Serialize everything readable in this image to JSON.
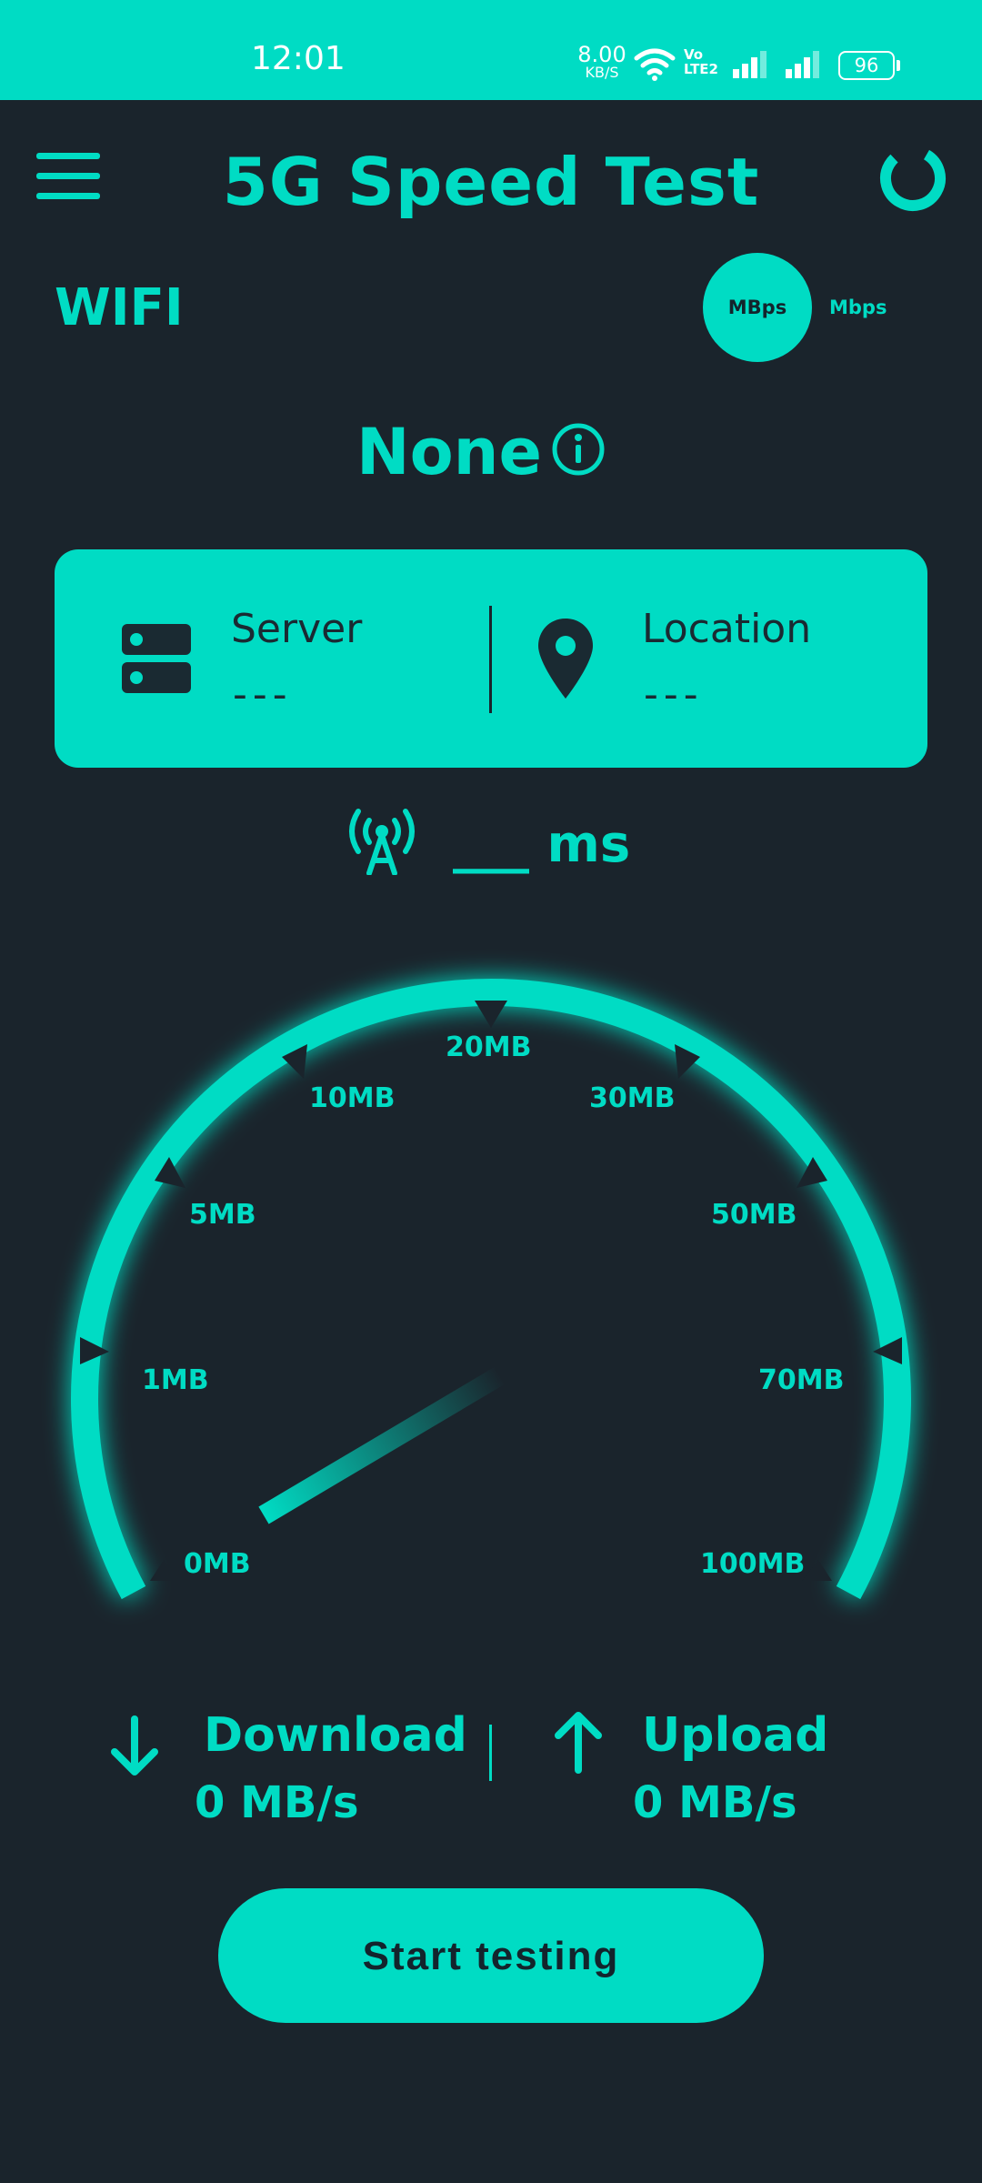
{
  "status_bar": {
    "time": "12:01",
    "net_speed": "8.00",
    "net_speed_unit": "KB/S",
    "volte_line1": "Vo",
    "volte_line2": "LTE2",
    "battery": "96"
  },
  "header": {
    "title": "5G Speed Test",
    "menu_icon": "hamburger-menu-icon",
    "refresh_icon": "circle-loader-icon"
  },
  "connection": {
    "type": "WIFI",
    "unit_selected": "MBps",
    "unit_other": "Mbps",
    "network_name": "None"
  },
  "server_card": {
    "server_label": "Server",
    "server_value": "---",
    "location_label": "Location",
    "location_value": "---"
  },
  "ping": {
    "value": "___ ms"
  },
  "gauge": {
    "labels": [
      "0MB",
      "1MB",
      "5MB",
      "10MB",
      "20MB",
      "30MB",
      "50MB",
      "70MB",
      "100MB"
    ],
    "needle_value": "0MB"
  },
  "stats": {
    "download_label": "Download",
    "download_value": "0 MB/s",
    "upload_label": "Upload",
    "upload_value": "0 MB/s"
  },
  "start_button": "Start testing",
  "colors": {
    "accent": "#00dcc4",
    "background": "#1a242c"
  }
}
